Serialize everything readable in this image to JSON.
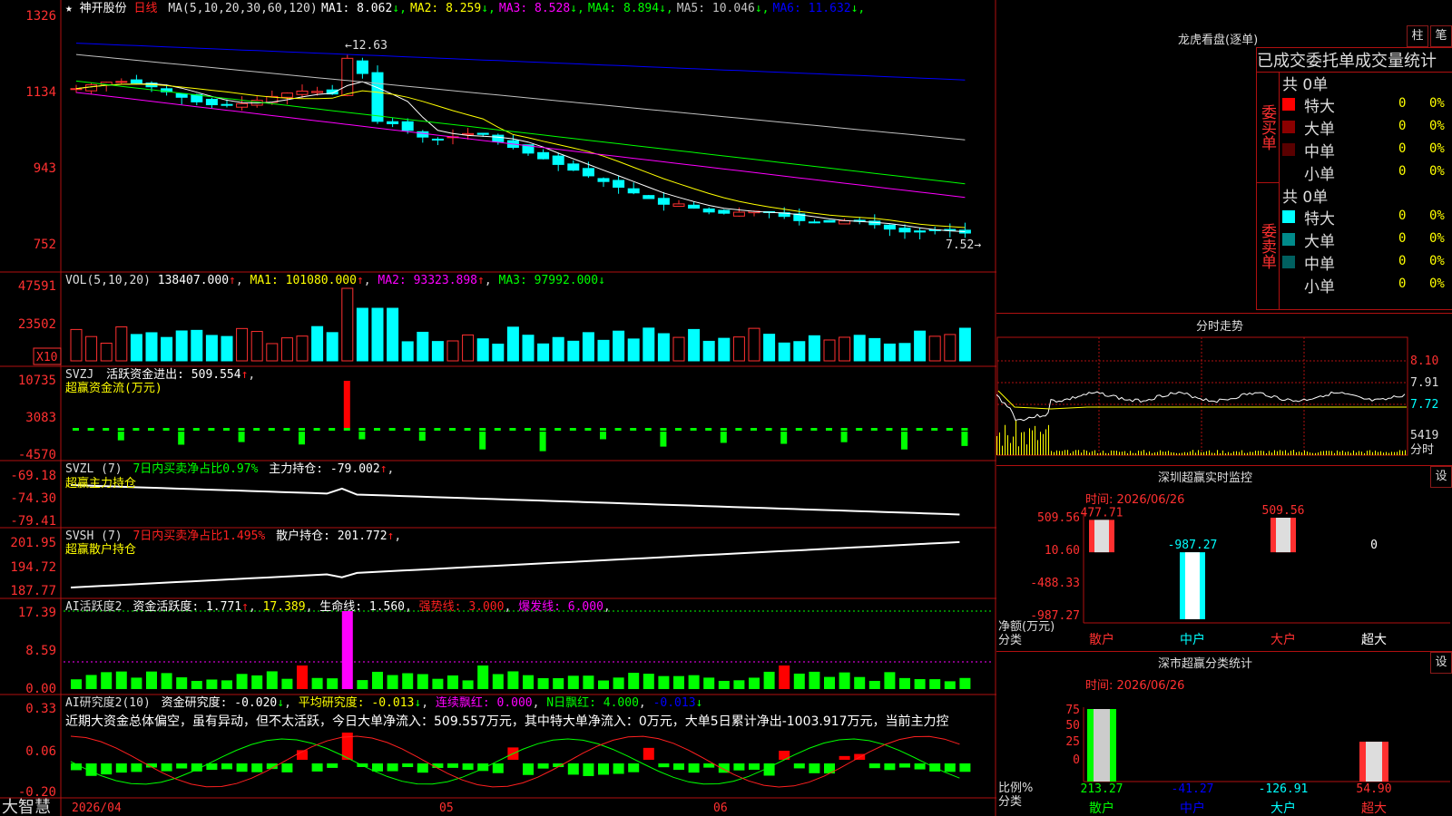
{
  "stock": {
    "name": "神开股份",
    "period": "日线",
    "ma_header": "MA(5,10,20,30,60,120)",
    "ma_values": [
      {
        "label": "MA1:",
        "value": "8.062",
        "arrow": "↓",
        "color": "#ffffff"
      },
      {
        "label": "MA2:",
        "value": "8.259",
        "arrow": "↓",
        "color": "#ffff00"
      },
      {
        "label": "MA3:",
        "value": "8.528",
        "arrow": "↓",
        "color": "#ff00ff"
      },
      {
        "label": "MA4:",
        "value": "8.894",
        "arrow": "↓",
        "color": "#00ff00"
      },
      {
        "label": "MA5:",
        "value": "10.046",
        "arrow": "↓",
        "color": "#c0c0c0"
      },
      {
        "label": "MA6:",
        "value": "11.632",
        "arrow": "↓",
        "color": "#0000ff"
      }
    ],
    "price_axis": [
      "1326",
      "1134",
      "943",
      "752"
    ],
    "high_marker": "12.63",
    "low_marker": "7.52"
  },
  "volume": {
    "header": "VOL(5,10,20)",
    "value": "138407.000",
    "ma1": "101080.000",
    "ma2": "93323.898",
    "ma3": "97992.000",
    "axis": [
      "47591",
      "23502"
    ],
    "unit": "X10"
  },
  "svzj": {
    "header": "SVZJ",
    "label": "活跃资金进出:",
    "value": "509.554",
    "subtitle": "超赢资金流(万元)",
    "axis": [
      "10735",
      "3083",
      "-4570"
    ]
  },
  "svzl": {
    "header": "SVZL (7)",
    "ratio_text": "7日内买卖净占比0.97%",
    "label": "主力持仓:",
    "value": "-79.002",
    "subtitle": "超赢主力持仓",
    "axis": [
      "-69.18",
      "-74.30",
      "-79.41"
    ]
  },
  "svsh": {
    "header": "SVSH (7)",
    "ratio_text": "7日内买卖净占比1.495%",
    "label": "散户持仓:",
    "value": "201.772",
    "subtitle": "超赢散户持仓",
    "axis": [
      "201.95",
      "194.72",
      "187.77"
    ]
  },
  "ai_active": {
    "header": "AI活跃度2",
    "label1": "资金活跃度:",
    "value1": "1.771",
    "value2": "17.389",
    "label3": "生命线:",
    "value3": "1.560",
    "label4": "强势线:",
    "value4": "3.000",
    "label5": "爆发线:",
    "value5": "6.000",
    "axis": [
      "17.39",
      "8.59",
      "0.00"
    ]
  },
  "ai_research": {
    "header": "AI研究度2(10)",
    "label1": "资金研究度:",
    "value1": "-0.020",
    "label2": "平均研究度:",
    "value2": "-0.013",
    "label3": "连续飘红:",
    "value3": "0.000",
    "label4": "N日飘红:",
    "value4": "4.000",
    "value5": "-0.013",
    "summary": "近期大资金总体偏空，虽有异动，但不太活跃，今日大单净流入：509.557万元，其中特大单净流入：0万元，大单5日累计净出-1003.917万元，当前主力控",
    "axis": [
      "0.33",
      "0.06",
      "-0.20"
    ]
  },
  "date_axis": [
    "2026/04",
    "05",
    "06"
  ],
  "brand": "大智慧",
  "lhb": {
    "title": "龙虎看盘(逐单)",
    "btn_bar": "柱",
    "btn_pen": "笔",
    "header": "已成交委托单成交量统计",
    "buy_side": "委买单",
    "sell_side": "委卖单",
    "total_buy": "共 0单",
    "total_sell": "共 0单",
    "buy_rows": [
      {
        "label": "特大",
        "count": "0",
        "pct": "0%",
        "color": "#ff0000"
      },
      {
        "label": "大单",
        "count": "0",
        "pct": "0%",
        "color": "#8b0000"
      },
      {
        "label": "中单",
        "count": "0",
        "pct": "0%",
        "color": "#5a0000"
      },
      {
        "label": "小单",
        "count": "0",
        "pct": "0%",
        "color": ""
      }
    ],
    "sell_rows": [
      {
        "label": "特大",
        "count": "0",
        "pct": "0%",
        "color": "#00ffff"
      },
      {
        "label": "大单",
        "count": "0",
        "pct": "0%",
        "color": "#008b8b"
      },
      {
        "label": "中单",
        "count": "0",
        "pct": "0%",
        "color": "#006060"
      },
      {
        "label": "小单",
        "count": "0",
        "pct": "0%",
        "color": ""
      }
    ]
  },
  "intraday": {
    "title": "分时走势",
    "axis": [
      "8.10",
      "7.91",
      "7.72"
    ],
    "vol_label": "5419",
    "vol_sub": "分时"
  },
  "monitor": {
    "title": "深圳超赢实时监控",
    "btn": "设",
    "date": "时间: 2026/06/26",
    "axis": [
      "509.56",
      "10.60",
      "-488.33",
      "-987.27"
    ],
    "y_label": "净额(万元)",
    "x_label": "分类",
    "bars": [
      {
        "cat": "散户",
        "value": 477.71,
        "label": "477.71",
        "cat_color": "#ff3030"
      },
      {
        "cat": "中户",
        "value": -987.27,
        "label": "-987.27",
        "cat_color": "#00ffff"
      },
      {
        "cat": "大户",
        "value": 509.56,
        "label": "509.56",
        "cat_color": "#ff3030"
      },
      {
        "cat": "超大",
        "value": 0,
        "label": "0",
        "cat_color": "#ffffff"
      }
    ]
  },
  "classify": {
    "title": "深市超赢分类统计",
    "btn": "设",
    "date": "时间: 2026/06/26",
    "axis": [
      "75",
      "50",
      "25",
      "0"
    ],
    "y_label": "比例%",
    "x_label": "分类",
    "bars": [
      {
        "cat": "散户",
        "value": 213.27,
        "label": "213.27"
      },
      {
        "cat": "中户",
        "value": -41.27,
        "label": "-41.27"
      },
      {
        "cat": "大户",
        "value": -126.91,
        "label": "-126.91"
      },
      {
        "cat": "超大",
        "value": 54.9,
        "label": "54.90"
      }
    ]
  }
}
